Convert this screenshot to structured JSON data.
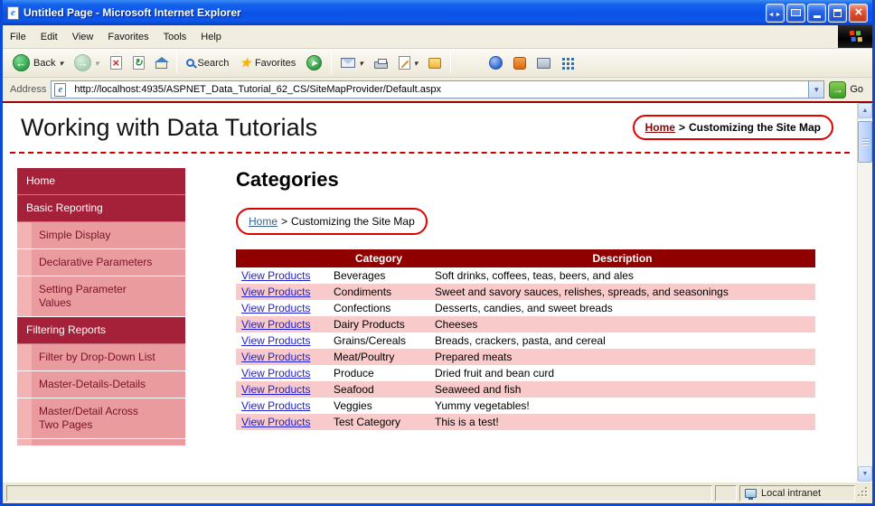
{
  "window": {
    "title": "Untitled Page - Microsoft Internet Explorer",
    "status": {
      "zone": "Local intranet"
    }
  },
  "menu": {
    "items": [
      "File",
      "Edit",
      "View",
      "Favorites",
      "Tools",
      "Help"
    ]
  },
  "toolbar": {
    "back": "Back",
    "search": "Search",
    "favorites": "Favorites"
  },
  "address": {
    "label": "Address",
    "url": "http://localhost:4935/ASPNET_Data_Tutorial_62_CS/SiteMapProvider/Default.aspx",
    "go": "Go"
  },
  "page": {
    "title": "Working with Data Tutorials",
    "header_breadcrumb": {
      "home": "Home",
      "separator": ">",
      "current": "Customizing the Site Map"
    },
    "sidebar": {
      "items": [
        {
          "label": "Home",
          "level": 0
        },
        {
          "label": "Basic Reporting",
          "level": 0
        },
        {
          "label": "Simple Display",
          "level": 1
        },
        {
          "label": "Declarative Parameters",
          "level": 1
        },
        {
          "label": "Setting Parameter Values",
          "level": 1
        },
        {
          "label": "Filtering Reports",
          "level": 0
        },
        {
          "label": "Filter by Drop-Down List",
          "level": 1
        },
        {
          "label": "Master-Details-Details",
          "level": 1
        },
        {
          "label": "Master/Detail Across Two Pages",
          "level": 1
        }
      ]
    },
    "content": {
      "heading": "Categories",
      "breadcrumb": {
        "home": "Home",
        "separator": ">",
        "current": "Customizing the Site Map"
      },
      "table": {
        "headers": [
          "",
          "Category",
          "Description"
        ],
        "link_label": "View Products",
        "rows": [
          {
            "category": "Beverages",
            "description": "Soft drinks, coffees, teas, beers, and ales"
          },
          {
            "category": "Condiments",
            "description": "Sweet and savory sauces, relishes, spreads, and seasonings"
          },
          {
            "category": "Confections",
            "description": "Desserts, candies, and sweet breads"
          },
          {
            "category": "Dairy Products",
            "description": "Cheeses"
          },
          {
            "category": "Grains/Cereals",
            "description": "Breads, crackers, pasta, and cereal"
          },
          {
            "category": "Meat/Poultry",
            "description": "Prepared meats"
          },
          {
            "category": "Produce",
            "description": "Dried fruit and bean curd"
          },
          {
            "category": "Seafood",
            "description": "Seaweed and fish"
          },
          {
            "category": "Veggies",
            "description": "Yummy vegetables!"
          },
          {
            "category": "Test Category",
            "description": "This is a test!"
          }
        ]
      }
    }
  },
  "colors": {
    "titlebar_blue": "#0B52E8",
    "table_header_maroon": "#900000",
    "sidebar_crimson": "#A52039",
    "sidebar_pink": "#EA9B9E",
    "row_pink": "#F8CACA",
    "annotation_red": "#E00000",
    "link_blue": "#2222CC",
    "breadcrumb_home_red": "#8B0000"
  }
}
